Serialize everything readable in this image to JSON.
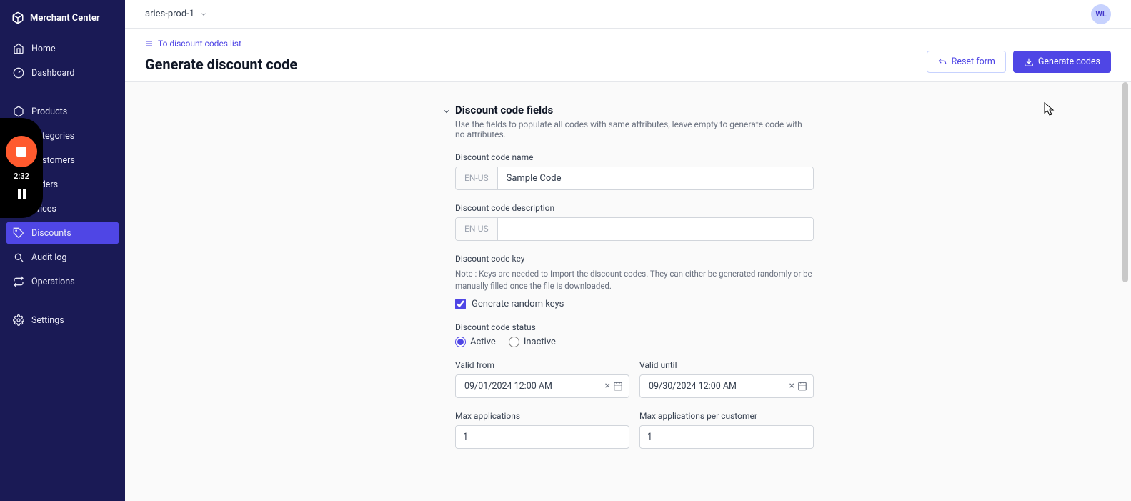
{
  "brand": {
    "name": "Merchant Center"
  },
  "sidebar": {
    "items": [
      {
        "label": "Home"
      },
      {
        "label": "Dashboard"
      },
      {
        "label": "Products"
      },
      {
        "label": "Categories"
      },
      {
        "label": "Customers"
      },
      {
        "label": "Orders"
      },
      {
        "label": "Prices"
      },
      {
        "label": "Discounts"
      },
      {
        "label": "Audit log"
      },
      {
        "label": "Operations"
      },
      {
        "label": "Settings"
      }
    ]
  },
  "topbar": {
    "project": "aries-prod-1",
    "avatar": "WL"
  },
  "page": {
    "breadcrumb": "To discount codes list",
    "title": "Generate discount code",
    "reset": "Reset form",
    "generate": "Generate codes"
  },
  "section": {
    "title": "Discount code fields",
    "desc": "Use the fields to populate all codes with same attributes, leave empty to generate code with no attributes."
  },
  "form": {
    "locale": "EN-US",
    "name_label": "Discount code name",
    "name_value": "Sample Code",
    "desc_label": "Discount code description",
    "desc_value": "",
    "key_label": "Discount code key",
    "key_note": "Note : Keys are needed to Import the discount codes. They can either be generated randomly or be manually filled once the file is downloaded.",
    "key_checkbox": "Generate random keys",
    "status_label": "Discount code status",
    "status_active": "Active",
    "status_inactive": "Inactive",
    "valid_from_label": "Valid from",
    "valid_from_value": "09/01/2024 12:00 AM",
    "valid_until_label": "Valid until",
    "valid_until_value": "09/30/2024 12:00 AM",
    "max_app_label": "Max applications",
    "max_app_value": "1",
    "max_cust_label": "Max applications per customer",
    "max_cust_value": "1"
  },
  "rec": {
    "time": "2:32"
  }
}
